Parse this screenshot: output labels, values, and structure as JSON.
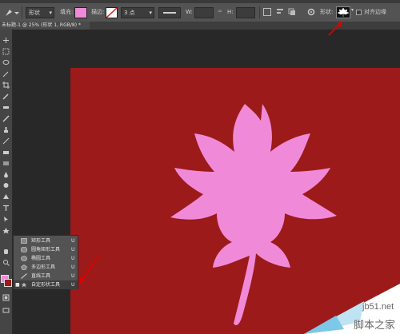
{
  "options_bar": {
    "mode_value": "形状",
    "fill_label": "填充:",
    "fill_color": "#f08ad8",
    "stroke_label": "描边:",
    "stroke_width_value": "3 点",
    "w_label": "W:",
    "h_label": "H:",
    "shape_label": "形状:",
    "align_edges_label": "对齐边缘"
  },
  "document_tab": {
    "title": "未标题-1 @ 25% (形状 1, RGB/8) *"
  },
  "tool_flyout": {
    "items": [
      {
        "label": "矩形工具",
        "shortcut": "U",
        "icon": "rectangle-icon"
      },
      {
        "label": "圆角矩形工具",
        "shortcut": "U",
        "icon": "rounded-rectangle-icon"
      },
      {
        "label": "椭圆工具",
        "shortcut": "U",
        "icon": "ellipse-icon"
      },
      {
        "label": "多边形工具",
        "shortcut": "U",
        "icon": "polygon-icon"
      },
      {
        "label": "直线工具",
        "shortcut": "U",
        "icon": "line-icon"
      },
      {
        "label": "自定形状工具",
        "shortcut": "U",
        "icon": "custom-shape-icon",
        "selected": true
      }
    ]
  },
  "canvas": {
    "background_color": "#9c1a1a",
    "shape_color": "#f08ad8",
    "shape": "maple-leaf"
  },
  "watermark": {
    "site": "jb51.net",
    "name": "脚本之家"
  },
  "annotations": {
    "arrow_color": "#e00000"
  }
}
